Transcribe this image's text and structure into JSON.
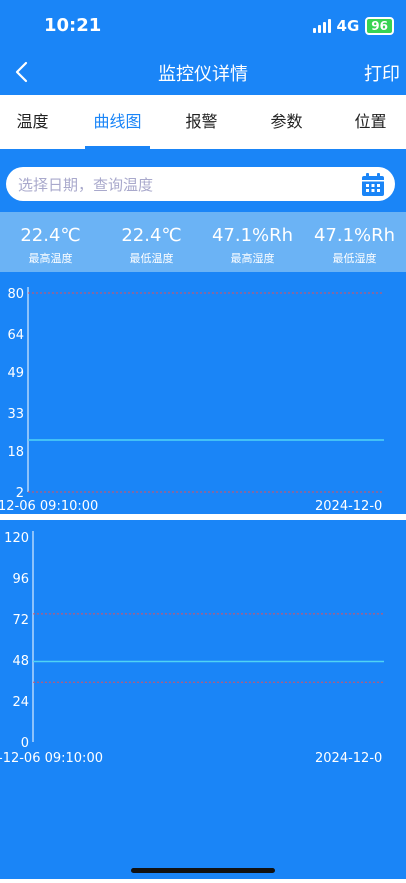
{
  "status_bar": {
    "time": "10:21",
    "network": "4G",
    "battery": "96"
  },
  "nav": {
    "title": "监控仪详情",
    "print_label": "打印"
  },
  "tabs": [
    {
      "label": "温度",
      "active": false
    },
    {
      "label": "曲线图",
      "active": true
    },
    {
      "label": "报警",
      "active": false
    },
    {
      "label": "参数",
      "active": false
    },
    {
      "label": "位置",
      "active": false
    }
  ],
  "search": {
    "placeholder": "选择日期，查询温度"
  },
  "stats": [
    {
      "value": "22.4℃",
      "label": "最高温度"
    },
    {
      "value": "22.4℃",
      "label": "最低温度"
    },
    {
      "value": "47.1%Rh",
      "label": "最高湿度"
    },
    {
      "value": "47.1%Rh",
      "label": "最低湿度"
    }
  ],
  "colors": {
    "accent": "#1a85f7",
    "series_line": "#4fd3f5",
    "limit_line": "#e0505a",
    "axis": "#ffffff"
  },
  "chart_data": [
    {
      "type": "line",
      "title": "",
      "yticks": [
        "80",
        "64",
        "49",
        "33",
        "18",
        "2"
      ],
      "ylim": [
        2,
        80
      ],
      "x_labels": [
        "12-06 09:10:00",
        "2024-12-0"
      ],
      "series": [
        {
          "values": [
            22.4,
            22.4
          ]
        }
      ],
      "limits": [
        80,
        2
      ],
      "grid": false
    },
    {
      "type": "line",
      "title": "",
      "yticks": [
        "120",
        "96",
        "72",
        "48",
        "24",
        "0"
      ],
      "ylim": [
        0,
        120
      ],
      "x_labels": [
        "-12-06 09:10:00",
        "2024-12-0"
      ],
      "series": [
        {
          "values": [
            47.1,
            47.1
          ]
        }
      ],
      "limits": [
        75,
        35
      ],
      "grid": false
    }
  ]
}
